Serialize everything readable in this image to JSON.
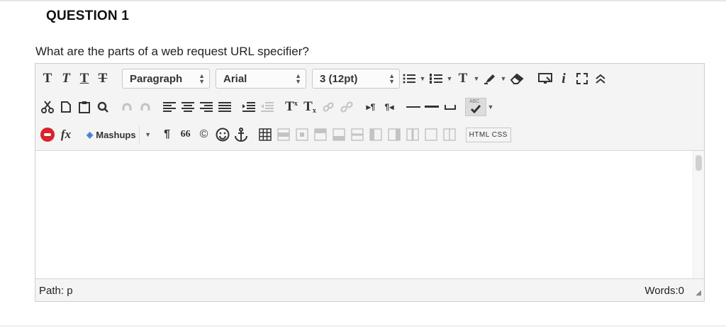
{
  "question": {
    "title": "QUESTION 1",
    "text": "What are the parts of a web request URL specifier?"
  },
  "toolbar": {
    "format_select": "Paragraph",
    "font_select": "Arial",
    "size_select": "3 (12pt)",
    "mashups_label": "Mashups",
    "html_label": "HTML",
    "css_label": "CSS",
    "glyphs": {
      "bold": "T",
      "italic": "T",
      "underline": "T",
      "strike": "T",
      "text_color": "T",
      "info": "i",
      "superscript": "T",
      "subscript": "T",
      "formula": "fx",
      "para_mark": "¶",
      "quote": "66",
      "copyright": "©",
      "ltr": "¶",
      "rtl": "¶",
      "spell": "ABC"
    }
  },
  "status": {
    "path": "Path: p",
    "words": "Words:0"
  },
  "colors": {
    "toolbar_bg": "#f4f4f4",
    "record_icon": "#d9232d",
    "mashups_icon": "#3a7bd5",
    "border": "#cfcfcf"
  }
}
